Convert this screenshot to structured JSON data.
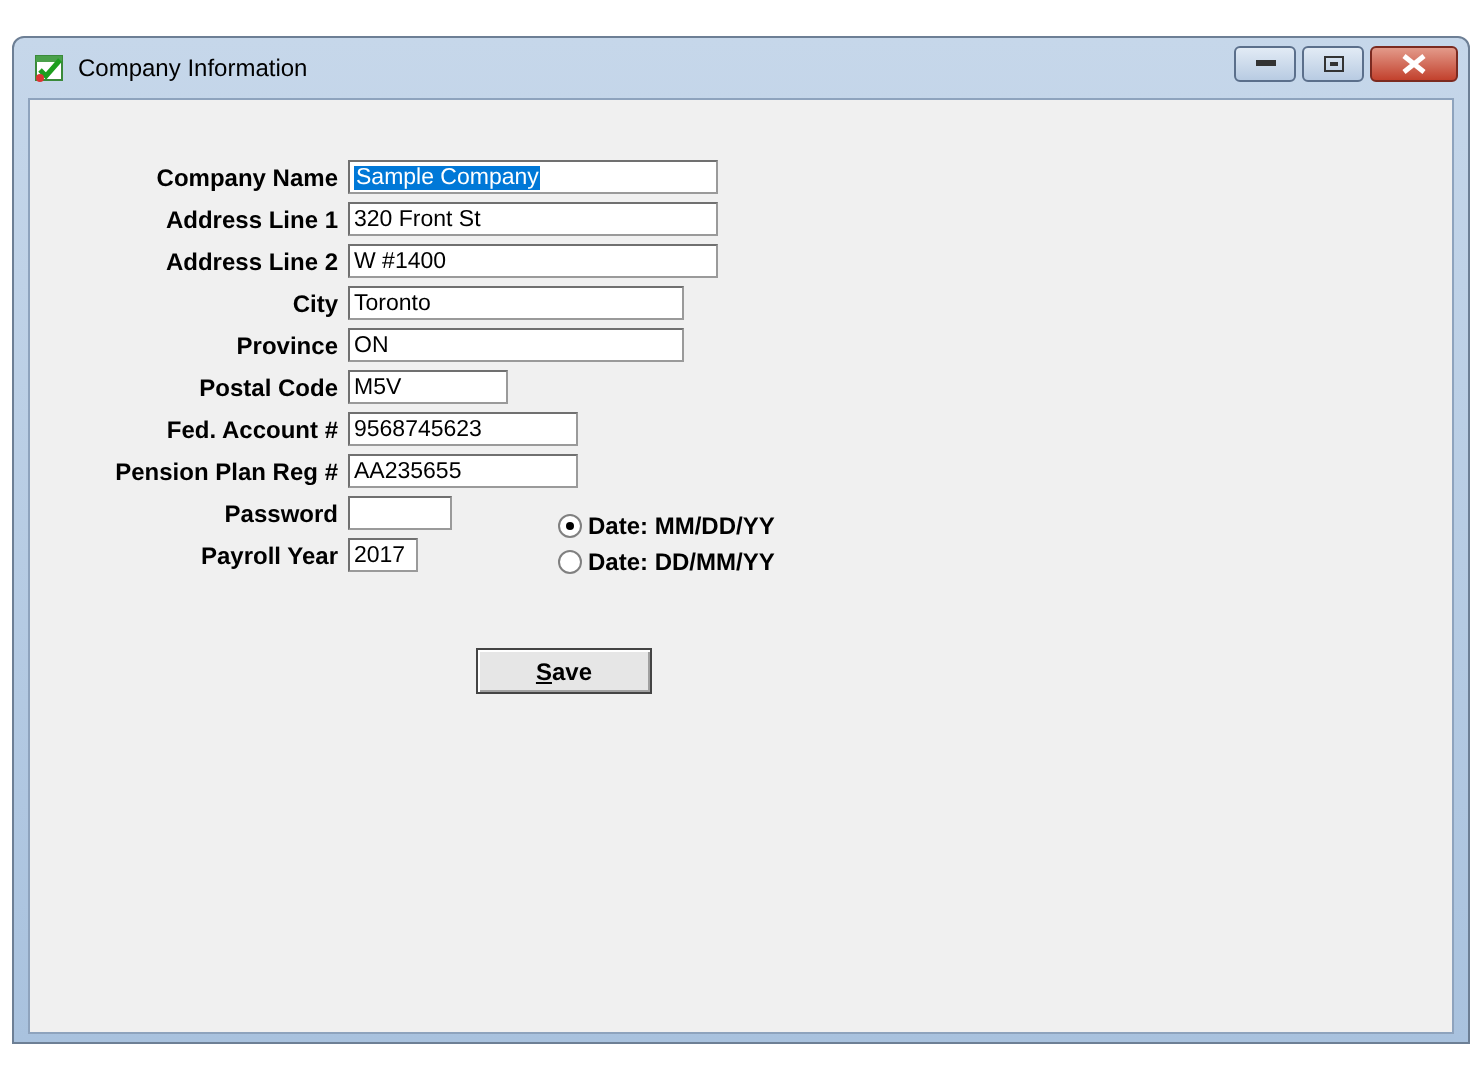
{
  "window": {
    "title": "Company Information"
  },
  "fields": [
    {
      "label": "Company Name",
      "value": "Sample Company",
      "highlighted": true
    },
    {
      "label": "Address Line 1",
      "value": "320 Front St",
      "highlighted": false
    },
    {
      "label": "Address Line 2",
      "value": "W #1400",
      "highlighted": false
    },
    {
      "label": "City",
      "value": "Toronto",
      "highlighted": false
    },
    {
      "label": "Province",
      "value": "ON",
      "highlighted": false
    },
    {
      "label": "Postal Code",
      "value": "M5V",
      "highlighted": false
    },
    {
      "label": "Fed. Account #",
      "value": "9568745623",
      "highlighted": false
    },
    {
      "label": "Pension Plan Reg #",
      "value": "AA235655",
      "highlighted": false
    },
    {
      "label": "Password"
    },
    {
      "label": "Payroll Year",
      "value": "2017",
      "highlighted": false
    }
  ],
  "date_formats": [
    {
      "label": "Date: MM/DD/YY",
      "selected": true
    },
    {
      "label": "Date: DD/MM/YY",
      "selected": false
    }
  ],
  "save_button": {
    "label": "Save"
  }
}
